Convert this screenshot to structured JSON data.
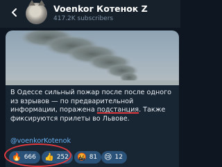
{
  "header": {
    "channel_title": "Voenkor Котенок Z",
    "subscribers": "417.2K subscribers",
    "back_icon": "arrow-left-icon",
    "avatar_icon": "cat-avatar"
  },
  "post": {
    "text_before": "В Одессе сильный пожар после после одного из взрывов — по предварительной информации, поражена ",
    "text_underlined": "подстанция",
    "text_after": ". Также фиксируются прилеты во Львове.",
    "link": "@voenkorKotenok",
    "photo": "smoke-plume-photo"
  },
  "reactions": [
    {
      "emoji": "🔥",
      "count": "666",
      "icon": "fire-icon"
    },
    {
      "emoji": "👍",
      "count": "252",
      "icon": "thumbs-up-icon"
    },
    {
      "emoji": "🤬",
      "count": "81",
      "icon": "angry-face-icon"
    },
    {
      "emoji": "😢",
      "count": "12",
      "icon": "crying-face-icon"
    }
  ],
  "colors": {
    "background": "#0e1621",
    "header": "#17212b",
    "bubble": "#182533",
    "reaction": "#2b5278",
    "link": "#6ab3f3",
    "annotation": "#e0393e"
  }
}
